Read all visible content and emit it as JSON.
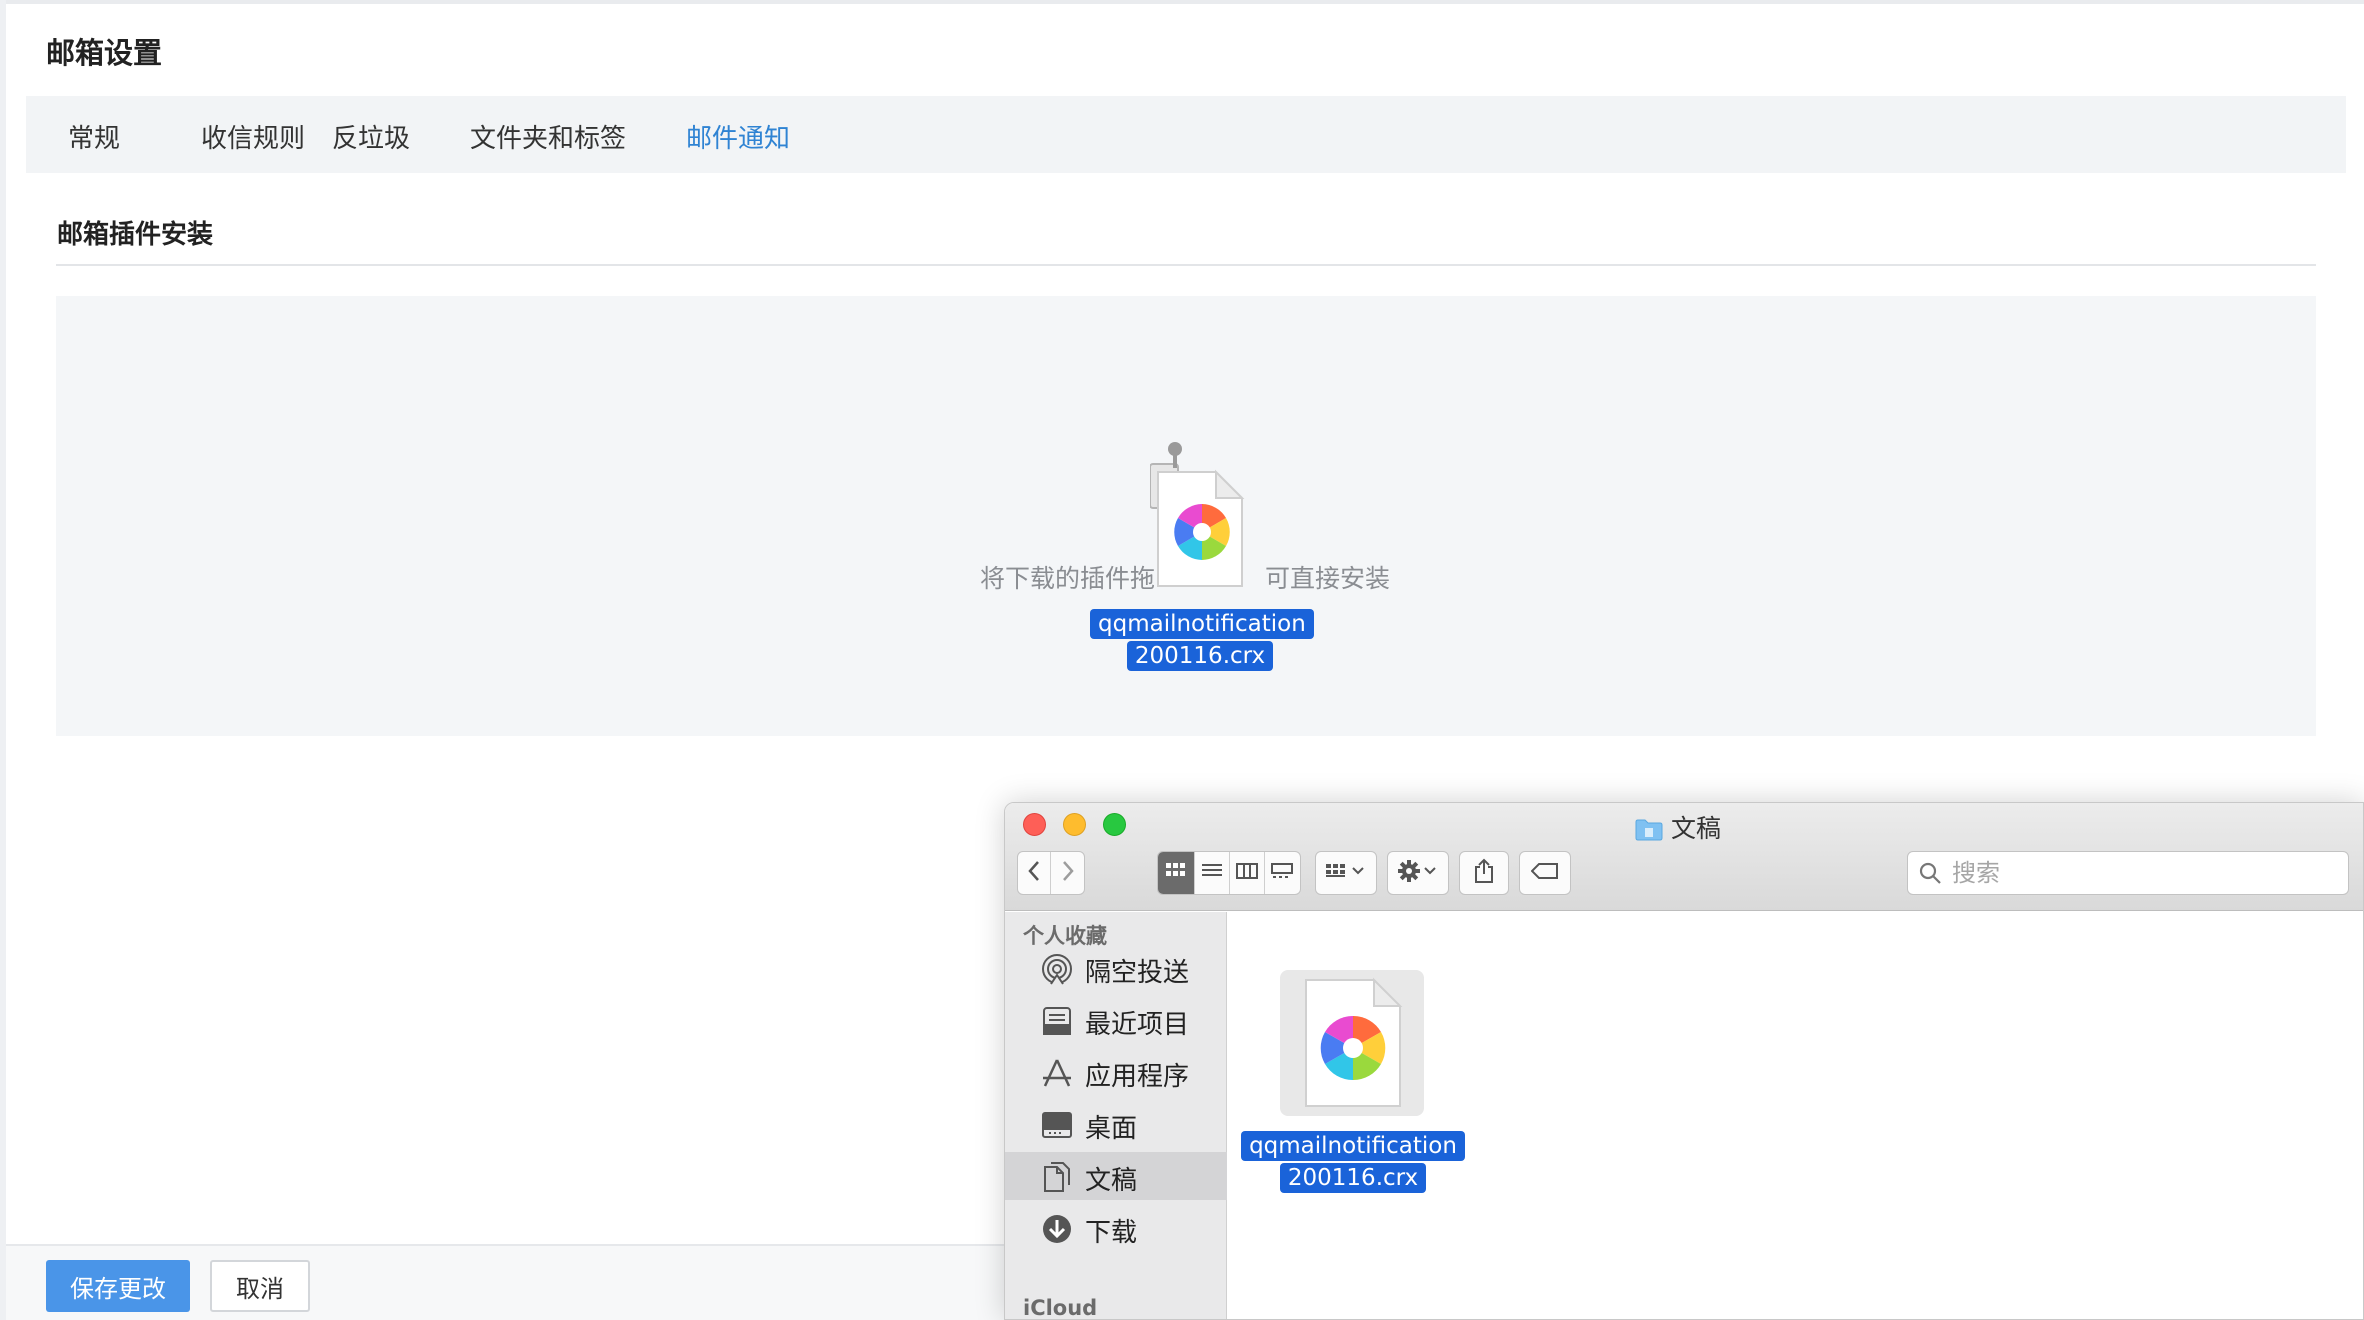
{
  "page": {
    "title": "邮箱设置",
    "tabs": [
      {
        "label": "常规"
      },
      {
        "label": "收信规则"
      },
      {
        "label": "反垃圾"
      },
      {
        "label": "文件夹和标签"
      },
      {
        "label": "邮件通知",
        "active": true
      }
    ],
    "section_title": "邮箱插件安装",
    "drop_hint_left": "将下载的插件拖",
    "drop_hint_right": "可直接安装",
    "dragging_file": {
      "line1": "qqmailnotification",
      "line2": "200116.crx"
    },
    "save_button": "保存更改",
    "cancel_button": "取消"
  },
  "finder": {
    "title": "文稿",
    "toolbar": {
      "back_icon": "chevron-left-icon",
      "forward_icon": "chevron-right-icon",
      "views": [
        "icon-view",
        "list-view",
        "column-view",
        "gallery-view"
      ],
      "active_view": "icon-view",
      "group_icon": "group-icon",
      "action_icon": "gear-icon",
      "share_icon": "share-icon",
      "tag_icon": "tag-icon",
      "search_placeholder": "搜索"
    },
    "sidebar": {
      "favorites_header": "个人收藏",
      "items": [
        {
          "label": "隔空投送",
          "icon": "airdrop-icon"
        },
        {
          "label": "最近项目",
          "icon": "recents-icon"
        },
        {
          "label": "应用程序",
          "icon": "applications-icon"
        },
        {
          "label": "桌面",
          "icon": "desktop-icon"
        },
        {
          "label": "文稿",
          "icon": "documents-icon",
          "active": true
        },
        {
          "label": "下载",
          "icon": "downloads-icon"
        }
      ],
      "icloud_header": "iCloud"
    },
    "files": [
      {
        "line1": "qqmailnotification",
        "line2": "200116.crx",
        "selected": true
      }
    ]
  },
  "colors": {
    "accent": "#2f83d3",
    "selection": "#1a63d9",
    "save_button": "#4a95e8"
  }
}
